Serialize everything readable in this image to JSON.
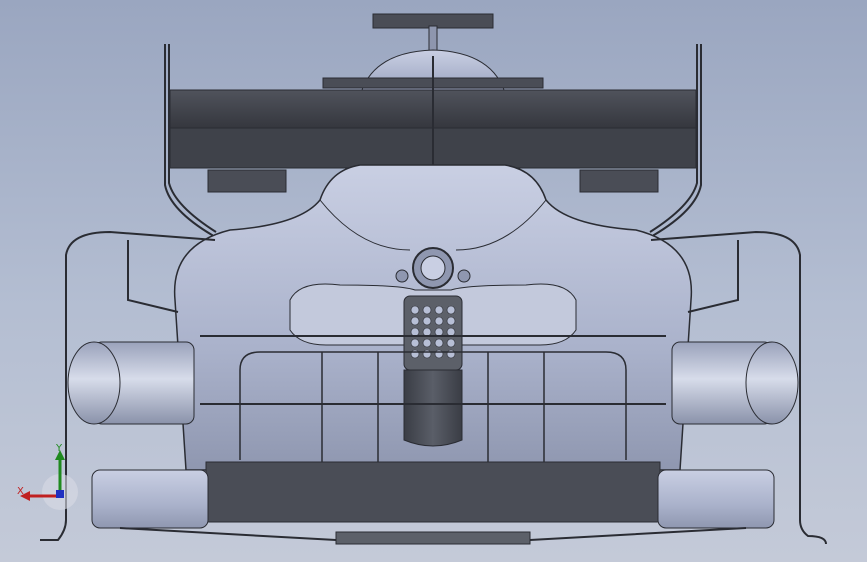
{
  "viewport": {
    "background_top": "#9aa6c0",
    "background_bottom": "#c4cad8",
    "model_fill": "#b7bfd6",
    "model_dark": "#3c3f47",
    "model_edge": "#2a2c33"
  },
  "triad": {
    "x_label": "X",
    "y_label": "Y",
    "x_color": "#c02020",
    "y_color": "#1f8a1f",
    "z_color": "#2030c0"
  }
}
